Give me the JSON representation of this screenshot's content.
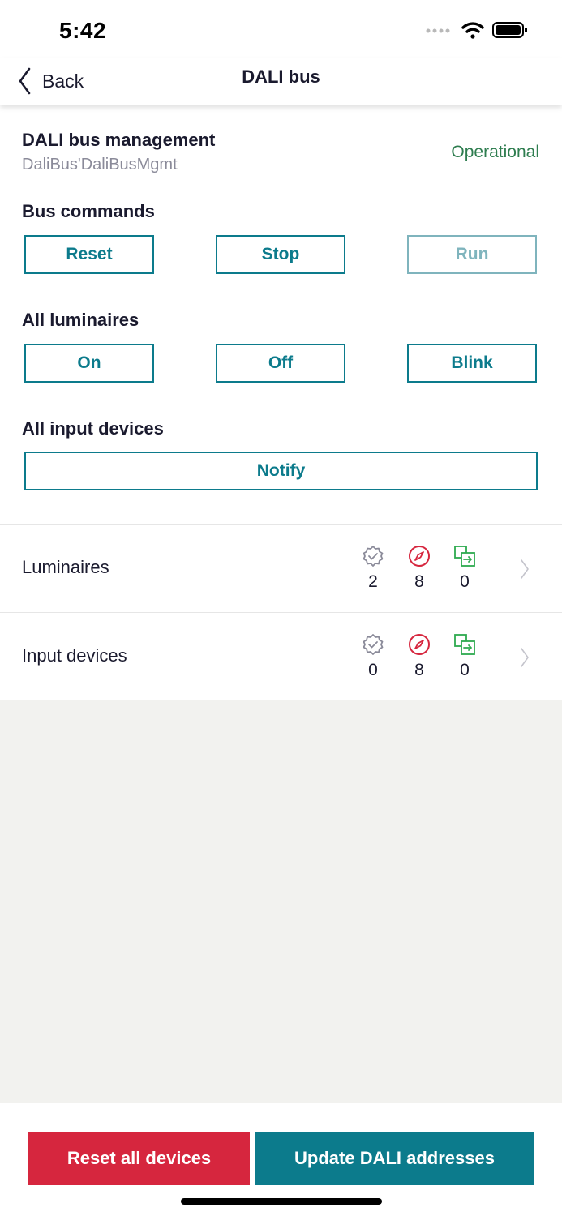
{
  "status_bar": {
    "time": "5:42"
  },
  "nav": {
    "back_label": "Back",
    "title": "DALI bus"
  },
  "management": {
    "title": "DALI bus management",
    "subtitle": "DaliBus'DaliBusMgmt",
    "status": "Operational",
    "status_color": "#2e7d4f"
  },
  "bus_commands": {
    "label": "Bus commands",
    "reset": "Reset",
    "stop": "Stop",
    "run": "Run"
  },
  "all_luminaires": {
    "label": "All luminaires",
    "on": "On",
    "off": "Off",
    "blink": "Blink"
  },
  "all_input_devices": {
    "label": "All input devices",
    "notify": "Notify"
  },
  "rows": [
    {
      "label": "Luminaires",
      "ok_count": "2",
      "fault_count": "8",
      "assigned_count": "0"
    },
    {
      "label": "Input devices",
      "ok_count": "0",
      "fault_count": "8",
      "assigned_count": "0"
    }
  ],
  "footer": {
    "reset_all": "Reset all devices",
    "update_addresses": "Update DALI addresses"
  },
  "colors": {
    "accent": "#0c7b8c",
    "danger": "#d6263e",
    "success": "#2e7d4f"
  },
  "icons": {
    "ok": "badge-check-icon",
    "fault": "compass-icon",
    "assigned": "copy-arrow-icon"
  }
}
